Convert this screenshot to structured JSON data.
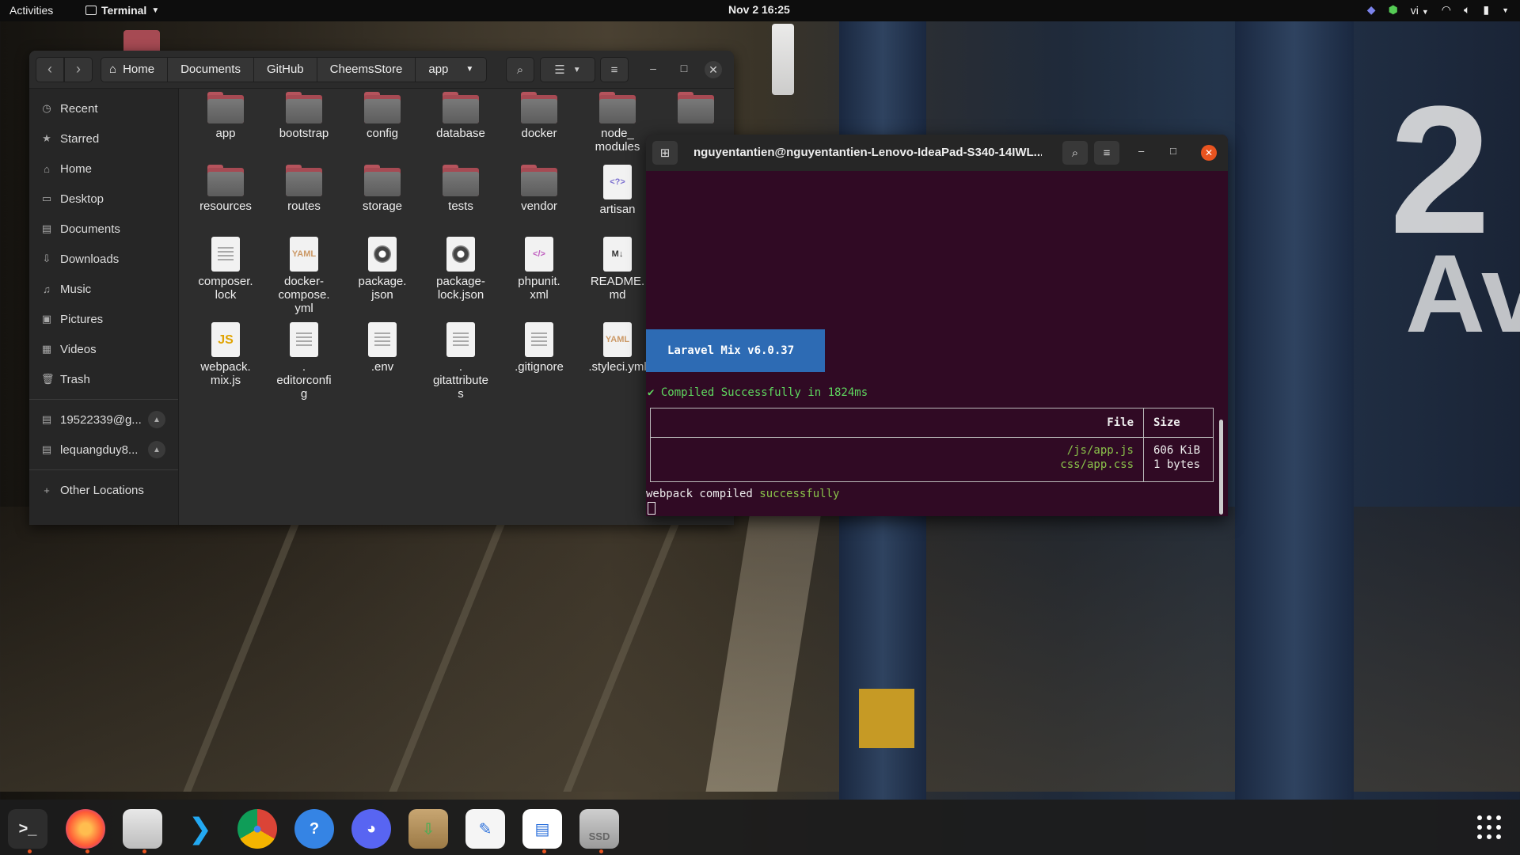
{
  "topbar": {
    "activities": "Activities",
    "app_name": "Terminal",
    "clock": "Nov 2  16:25",
    "input_method": "vi"
  },
  "wallpaper": {
    "sign_top": "2",
    "sign_bottom": "Av"
  },
  "files": {
    "breadcrumbs": [
      "Home",
      "Documents",
      "GitHub",
      "CheemsStore",
      "app"
    ],
    "sidebar": [
      {
        "label": "Recent",
        "icon": "clock-icon"
      },
      {
        "label": "Starred",
        "icon": "star-icon"
      },
      {
        "label": "Home",
        "icon": "home-icon"
      },
      {
        "label": "Desktop",
        "icon": "desktop-icon"
      },
      {
        "label": "Documents",
        "icon": "document-icon"
      },
      {
        "label": "Downloads",
        "icon": "download-icon"
      },
      {
        "label": "Music",
        "icon": "music-icon"
      },
      {
        "label": "Pictures",
        "icon": "picture-icon"
      },
      {
        "label": "Videos",
        "icon": "video-icon"
      },
      {
        "label": "Trash",
        "icon": "trash-icon"
      }
    ],
    "drives": [
      {
        "label": "19522339@g...",
        "icon": "network-drive-icon"
      },
      {
        "label": "lequangduy8...",
        "icon": "network-drive-icon"
      }
    ],
    "other_locations": "Other Locations",
    "items": [
      {
        "name": "app",
        "type": "folder"
      },
      {
        "name": "bootstrap",
        "type": "folder"
      },
      {
        "name": "config",
        "type": "folder"
      },
      {
        "name": "database",
        "type": "folder"
      },
      {
        "name": "docker",
        "type": "folder"
      },
      {
        "name": "node_\nmodules",
        "type": "folder"
      },
      {
        "name": "",
        "type": "folder"
      },
      {
        "name": "resources",
        "type": "folder"
      },
      {
        "name": "routes",
        "type": "folder"
      },
      {
        "name": "storage",
        "type": "folder"
      },
      {
        "name": "tests",
        "type": "folder"
      },
      {
        "name": "vendor",
        "type": "folder"
      },
      {
        "name": "artisan",
        "type": "php",
        "glyph": "<?>"
      },
      {
        "name": "composer.\nlock",
        "type": "text"
      },
      {
        "name": "docker-\ncompose.\nyml",
        "type": "yaml",
        "glyph": "YAML"
      },
      {
        "name": "package.\njson",
        "type": "disc"
      },
      {
        "name": "package-\nlock.json",
        "type": "disc"
      },
      {
        "name": "phpunit.\nxml",
        "type": "xml",
        "glyph": "</>"
      },
      {
        "name": "README.\nmd",
        "type": "md",
        "glyph": "M↓"
      },
      {
        "name": "webpack.\nmix.js",
        "type": "js",
        "glyph": "JS"
      },
      {
        "name": ".\neditorconfi\ng",
        "type": "text"
      },
      {
        "name": ".env",
        "type": "text"
      },
      {
        "name": ".\ngitattribute\ns",
        "type": "text"
      },
      {
        "name": ".gitignore",
        "type": "text"
      },
      {
        "name": ".styleci.yml",
        "type": "yaml",
        "glyph": "YAML"
      }
    ]
  },
  "terminal": {
    "title": "nguyentantien@nguyentantien-Lenovo-IdeaPad-S340-14IWL...",
    "badge": "Laravel Mix v6.0.37",
    "compiled": "✔ Compiled Successfully in 1824ms",
    "table": {
      "headers": [
        "File",
        "Size"
      ],
      "rows": [
        [
          "/js/app.js",
          "606 KiB"
        ],
        [
          "css/app.css",
          "1 bytes"
        ]
      ]
    },
    "webpack_prefix": "webpack compiled ",
    "webpack_status": "successfully"
  },
  "dock": [
    {
      "name": "terminal",
      "icon": "terminal-icon",
      "running": true
    },
    {
      "name": "firefox",
      "icon": "firefox-icon",
      "running": true
    },
    {
      "name": "files",
      "icon": "files-icon",
      "running": true
    },
    {
      "name": "vscode",
      "icon": "vscode-icon",
      "running": false
    },
    {
      "name": "chrome",
      "icon": "chrome-icon",
      "running": false
    },
    {
      "name": "help",
      "icon": "help-icon",
      "running": false
    },
    {
      "name": "discord",
      "icon": "discord-icon",
      "running": false
    },
    {
      "name": "archive-manager",
      "icon": "archive-icon",
      "running": false
    },
    {
      "name": "text-editor",
      "icon": "text-editor-icon",
      "running": false
    },
    {
      "name": "libreoffice-writer",
      "icon": "writer-icon",
      "running": true
    },
    {
      "name": "ssd-drive",
      "icon": "ssd-icon",
      "label": "SSD",
      "running": true
    }
  ],
  "colors": {
    "terminal_bg": "#300a24",
    "accent": "#e95420",
    "badge": "#2d6bb4",
    "success": "#8ac34a"
  }
}
